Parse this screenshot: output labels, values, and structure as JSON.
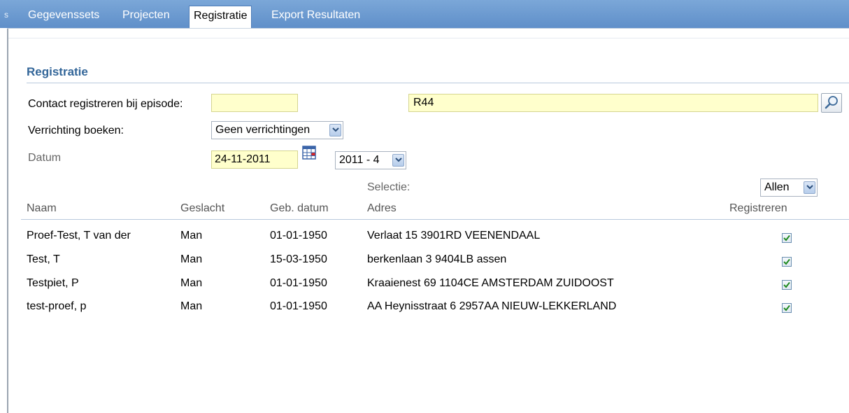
{
  "tabs": [
    {
      "label": "Gegevenssets",
      "active": false
    },
    {
      "label": "Projecten",
      "active": false
    },
    {
      "label": "Registratie",
      "active": true
    },
    {
      "label": "Export Resultaten",
      "active": false
    }
  ],
  "tab_stub": "s",
  "section": {
    "title": "Registratie"
  },
  "form": {
    "contact_label": "Contact registreren bij episode:",
    "contact_value": "",
    "episode_code": "R44",
    "verrichting_label": "Verrichting boeken:",
    "verrichting_value": "Geen verrichtingen",
    "datum_label": "Datum",
    "datum_value": "24-11-2011",
    "period_value": "2011 - 4",
    "selectie_label": "Selectie:",
    "selectie_value": "Allen"
  },
  "table": {
    "headers": {
      "naam": "Naam",
      "geslacht": "Geslacht",
      "geb_datum": "Geb. datum",
      "adres": "Adres",
      "registreren": "Registreren"
    },
    "rows": [
      {
        "naam": "Proef-Test, T van der",
        "geslacht": "Man",
        "geb_datum": "01-01-1950",
        "adres": "Verlaat 15 3901RD VEENENDAAL",
        "registreren": true
      },
      {
        "naam": "Test, T",
        "geslacht": "Man",
        "geb_datum": "15-03-1950",
        "adres": "berkenlaan 3 9404LB assen",
        "registreren": true
      },
      {
        "naam": "Testpiet, P",
        "geslacht": "Man",
        "geb_datum": "01-01-1950",
        "adres": "Kraaienest 69 1104CE AMSTERDAM ZUIDOOST",
        "registreren": true
      },
      {
        "naam": "test-proef, p",
        "geslacht": "Man",
        "geb_datum": "01-01-1950",
        "adres": "AA Heynisstraat 6 2957AA NIEUW-LEKKERLAND",
        "registreren": true
      }
    ]
  },
  "colors": {
    "tabbar": "#6b99d0",
    "section_title": "#336699",
    "input_bg": "#ffffcc"
  }
}
